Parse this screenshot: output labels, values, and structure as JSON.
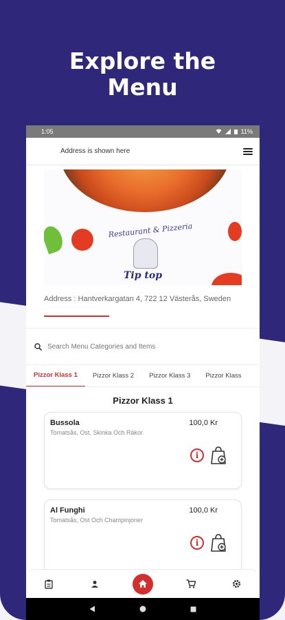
{
  "promo": {
    "headline_line1": "Explore the",
    "headline_line2": "Menu"
  },
  "status_bar": {
    "time": "1:05",
    "battery": "11%"
  },
  "topbar": {
    "address_hint": "Address is shown here"
  },
  "banner": {
    "restaurant_name": "Restaurant & Pizzeria",
    "brand": "Tip top"
  },
  "restaurant": {
    "address": "Address : Hantverkargatan 4, 722 12 Västerås, Sweden"
  },
  "search": {
    "placeholder": "Search Menu Categories and Items"
  },
  "tabs": [
    {
      "label": "Pizzor Klass 1"
    },
    {
      "label": "Pizzor Klass 2"
    },
    {
      "label": "Pizzor Klass 3"
    },
    {
      "label": "Pizzor Klass"
    }
  ],
  "section": {
    "title": "Pizzor Klass 1"
  },
  "items": [
    {
      "name": "Bussola",
      "description": "Tomatsås, Ost, Skinka Och Räkor",
      "price": "100,0 Kr"
    },
    {
      "name": "Al Funghi",
      "description": "Tomatsås, Ost Och Champinjoner",
      "price": "100,0 Kr"
    }
  ],
  "colors": {
    "brand_purple": "#2f2779",
    "accent_red": "#d32f2f"
  }
}
